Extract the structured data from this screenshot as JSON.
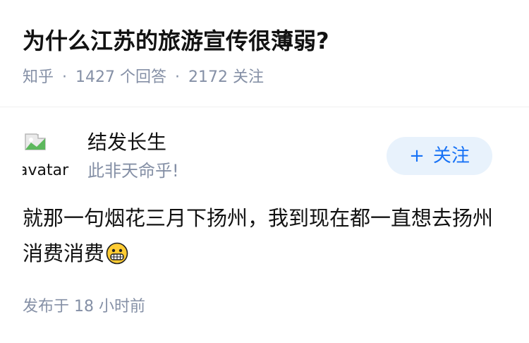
{
  "question": {
    "title": "为什么江苏的旅游宣传很薄弱?",
    "source": "知乎",
    "separator": "·",
    "answer_count": "1427",
    "answer_label": "个回答",
    "follower_count": "2172",
    "follower_label": "关注"
  },
  "author": {
    "avatar_alt": "avatar",
    "name": "结发长生",
    "bio": "此非天命乎!"
  },
  "follow_button": {
    "plus": "+",
    "label": "关注"
  },
  "answer": {
    "text": "就那一句烟花三月下扬州，我到现在都一直想去扬州消费消费",
    "emoji": "grimacing-face-icon"
  },
  "footer": {
    "publish_label": "发布于",
    "time": "18 小时前"
  },
  "colors": {
    "title": "#121212",
    "meta": "#8590a6",
    "accent": "#1772f6",
    "button_bg": "#e8f2fc"
  }
}
